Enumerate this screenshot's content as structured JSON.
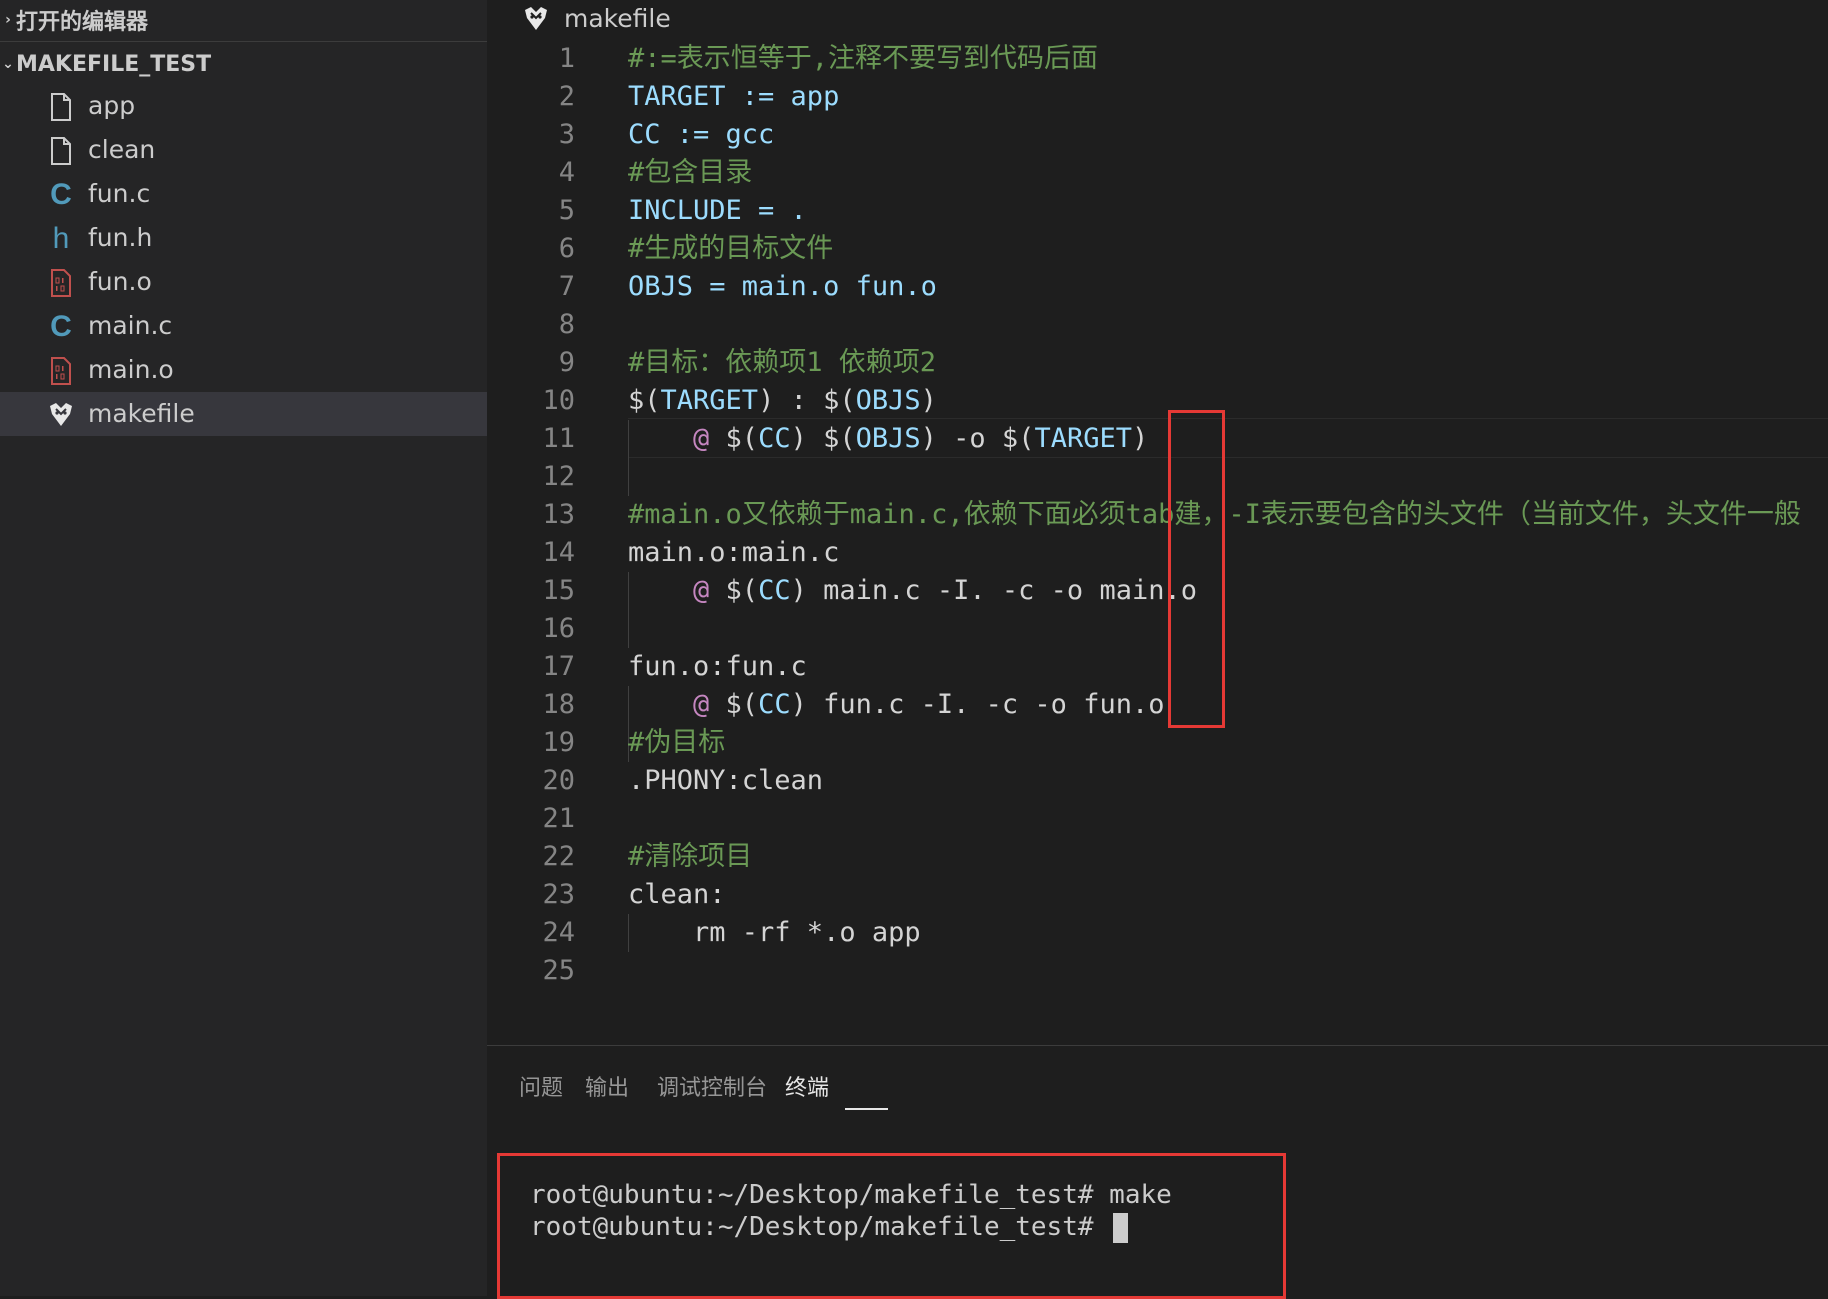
{
  "sidebar": {
    "open_editors_label": "打开的编辑器",
    "project_label": "MAKEFILE_TEST",
    "files": [
      {
        "name": "app",
        "icon": "file-icon"
      },
      {
        "name": "clean",
        "icon": "file-icon"
      },
      {
        "name": "fun.c",
        "icon": "c-language-icon",
        "glyph": "C"
      },
      {
        "name": "fun.h",
        "icon": "header-file-icon",
        "glyph": "h"
      },
      {
        "name": "fun.o",
        "icon": "binary-file-icon"
      },
      {
        "name": "main.c",
        "icon": "c-language-icon",
        "glyph": "C"
      },
      {
        "name": "main.o",
        "icon": "binary-file-icon"
      },
      {
        "name": "makefile",
        "icon": "makefile-icon",
        "selected": true
      }
    ]
  },
  "editor": {
    "tab_title": "makefile",
    "lines": [
      {
        "n": "1",
        "segs": [
          {
            "t": "#:=表示恒等于,注释不要写到代码后面",
            "c": "comment"
          }
        ]
      },
      {
        "n": "2",
        "segs": [
          {
            "t": "TARGET := app",
            "c": "var"
          }
        ]
      },
      {
        "n": "3",
        "segs": [
          {
            "t": "CC := gcc",
            "c": "var"
          }
        ]
      },
      {
        "n": "4",
        "segs": [
          {
            "t": "#包含目录",
            "c": "comment"
          }
        ]
      },
      {
        "n": "5",
        "segs": [
          {
            "t": "INCLUDE = .",
            "c": "var"
          }
        ]
      },
      {
        "n": "6",
        "segs": [
          {
            "t": "#生成的目标文件",
            "c": "comment"
          }
        ]
      },
      {
        "n": "7",
        "segs": [
          {
            "t": "OBJS = main.o fun.o",
            "c": "var"
          }
        ]
      },
      {
        "n": "8",
        "segs": []
      },
      {
        "n": "9",
        "segs": [
          {
            "t": "#目标：依赖项1 依赖项2",
            "c": "comment"
          }
        ]
      },
      {
        "n": "10",
        "segs": [
          {
            "t": "$(",
            "c": "plain"
          },
          {
            "t": "TARGET",
            "c": "var"
          },
          {
            "t": ") : $(",
            "c": "plain"
          },
          {
            "t": "OBJS",
            "c": "var"
          },
          {
            "t": ")",
            "c": "plain"
          }
        ]
      },
      {
        "n": "11",
        "segs": [
          {
            "t": "    ",
            "c": "plain"
          },
          {
            "t": "@",
            "c": "purple"
          },
          {
            "t": " $(",
            "c": "plain"
          },
          {
            "t": "CC",
            "c": "var"
          },
          {
            "t": ") $(",
            "c": "plain"
          },
          {
            "t": "OBJS",
            "c": "var"
          },
          {
            "t": ") -o $(",
            "c": "plain"
          },
          {
            "t": "TARGET",
            "c": "var"
          },
          {
            "t": ")",
            "c": "plain"
          }
        ]
      },
      {
        "n": "12",
        "segs": []
      },
      {
        "n": "13",
        "segs": [
          {
            "t": "#main.o又依赖于main.c,依赖下面必须tab建，-I表示要包含的头文件（当前文件，头文件一般",
            "c": "comment"
          }
        ]
      },
      {
        "n": "14",
        "segs": [
          {
            "t": "main.o:main.c",
            "c": "plain"
          }
        ]
      },
      {
        "n": "15",
        "segs": [
          {
            "t": "    ",
            "c": "plain"
          },
          {
            "t": "@",
            "c": "purple"
          },
          {
            "t": " $(",
            "c": "plain"
          },
          {
            "t": "CC",
            "c": "var"
          },
          {
            "t": ") main.c -I. -c -o main.o",
            "c": "plain"
          }
        ]
      },
      {
        "n": "16",
        "segs": []
      },
      {
        "n": "17",
        "segs": [
          {
            "t": "fun.o:fun.c",
            "c": "plain"
          }
        ]
      },
      {
        "n": "18",
        "segs": [
          {
            "t": "    ",
            "c": "plain"
          },
          {
            "t": "@",
            "c": "purple"
          },
          {
            "t": " $(",
            "c": "plain"
          },
          {
            "t": "CC",
            "c": "var"
          },
          {
            "t": ") fun.c -I. -c -o fun.o",
            "c": "plain"
          }
        ]
      },
      {
        "n": "19",
        "segs": [
          {
            "t": "#伪目标",
            "c": "comment"
          }
        ]
      },
      {
        "n": "20",
        "segs": [
          {
            "t": ".PHONY:clean",
            "c": "plain"
          }
        ]
      },
      {
        "n": "21",
        "segs": []
      },
      {
        "n": "22",
        "segs": [
          {
            "t": "#清除项目",
            "c": "comment"
          }
        ]
      },
      {
        "n": "23",
        "segs": [
          {
            "t": "clean:",
            "c": "plain"
          }
        ]
      },
      {
        "n": "24",
        "segs": [
          {
            "t": "    rm -rf *.o app",
            "c": "plain"
          }
        ]
      },
      {
        "n": "25",
        "segs": []
      }
    ]
  },
  "panel": {
    "tabs": [
      {
        "label": "问题",
        "name": "tab-problems"
      },
      {
        "label": "输出",
        "name": "tab-output"
      },
      {
        "label": "调试控制台",
        "name": "tab-debug-console"
      },
      {
        "label": "终端",
        "name": "tab-terminal",
        "active": true
      }
    ],
    "terminal_lines": [
      "root@ubuntu:~/Desktop/makefile_test# make",
      "root@ubuntu:~/Desktop/makefile_test# "
    ]
  },
  "colors": {
    "comment": "#6a9955",
    "variable": "#9cdcfe",
    "keyword_at": "#c586c0",
    "highlight_box": "#e53935"
  }
}
